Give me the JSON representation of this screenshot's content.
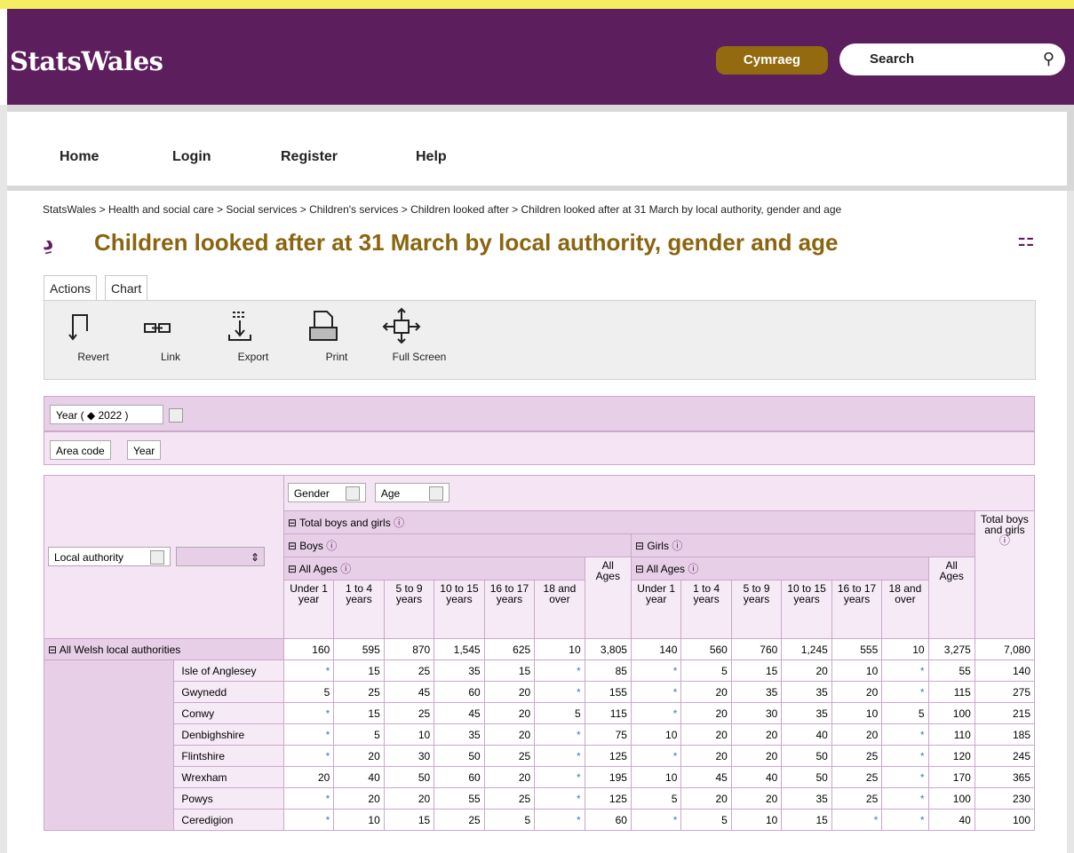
{
  "header": {
    "logo": "StatsWales",
    "lang_button": "Cymraeg",
    "search_label": "Search"
  },
  "nav": {
    "items": [
      "Home",
      "Login",
      "Register",
      "Help"
    ]
  },
  "breadcrumbs": [
    "StatsWales",
    "Health and social care",
    "Social services",
    "Children's services",
    "Children looked after",
    "Children looked after at 31 March by local authority, gender and age"
  ],
  "breadcrumb_sep": " > ",
  "page_title": "Children looked after at 31 March by local authority, gender and age",
  "tabs": [
    "Actions",
    "Chart"
  ],
  "toolbar": [
    "Revert",
    "Link",
    "Export",
    "Print",
    "Full Screen"
  ],
  "filters": {
    "year": "Year ( ◆ 2022 )",
    "area_code": "Area code",
    "year_btn": "Year",
    "gender": "Gender",
    "age": "Age",
    "local_authority": "Local authority"
  },
  "headers": {
    "total": "Total boys and girls",
    "boys": "Boys",
    "girls": "Girls",
    "all_ages": "All Ages",
    "age_groups": [
      "Under 1 year",
      "1 to 4 years",
      "5 to 9 years",
      "10 to 15 years",
      "16 to 17 years",
      "18 and over"
    ],
    "all_ages_col": "All Ages",
    "total_col": "Total boys and girls"
  },
  "colors": {
    "purple": "#5c1e5c",
    "gold": "#946a10",
    "yellow": "#f6ee62",
    "lilac": "#e8cfe8"
  },
  "rows": [
    {
      "name": "All Welsh local authorities",
      "values": [
        "160",
        "595",
        "870",
        "1,545",
        "625",
        "10",
        "3,805",
        "140",
        "560",
        "760",
        "1,245",
        "555",
        "10",
        "3,275",
        "7,080"
      ]
    },
    {
      "name": "Isle of Anglesey",
      "values": [
        "*",
        "15",
        "25",
        "35",
        "15",
        "*",
        "85",
        "*",
        "5",
        "15",
        "20",
        "10",
        "*",
        "55",
        "140"
      ]
    },
    {
      "name": "Gwynedd",
      "values": [
        "5",
        "25",
        "45",
        "60",
        "20",
        "*",
        "155",
        "*",
        "20",
        "35",
        "35",
        "20",
        "*",
        "115",
        "275"
      ]
    },
    {
      "name": "Conwy",
      "values": [
        "*",
        "15",
        "25",
        "45",
        "20",
        "5",
        "115",
        "*",
        "20",
        "30",
        "35",
        "10",
        "5",
        "100",
        "215"
      ]
    },
    {
      "name": "Denbighshire",
      "values": [
        "*",
        "5",
        "10",
        "35",
        "20",
        "*",
        "75",
        "10",
        "20",
        "20",
        "40",
        "20",
        "*",
        "110",
        "185"
      ]
    },
    {
      "name": "Flintshire",
      "values": [
        "*",
        "20",
        "30",
        "50",
        "25",
        "*",
        "125",
        "*",
        "20",
        "20",
        "50",
        "25",
        "*",
        "120",
        "245"
      ]
    },
    {
      "name": "Wrexham",
      "values": [
        "20",
        "40",
        "50",
        "60",
        "20",
        "*",
        "195",
        "10",
        "45",
        "40",
        "50",
        "25",
        "*",
        "170",
        "365"
      ]
    },
    {
      "name": "Powys",
      "values": [
        "*",
        "20",
        "20",
        "55",
        "25",
        "*",
        "125",
        "5",
        "20",
        "20",
        "35",
        "25",
        "*",
        "100",
        "230"
      ]
    },
    {
      "name": "Ceredigion",
      "values": [
        "*",
        "10",
        "15",
        "25",
        "5",
        "*",
        "60",
        "*",
        "5",
        "10",
        "15",
        "*",
        "*",
        "40",
        "100"
      ]
    }
  ]
}
